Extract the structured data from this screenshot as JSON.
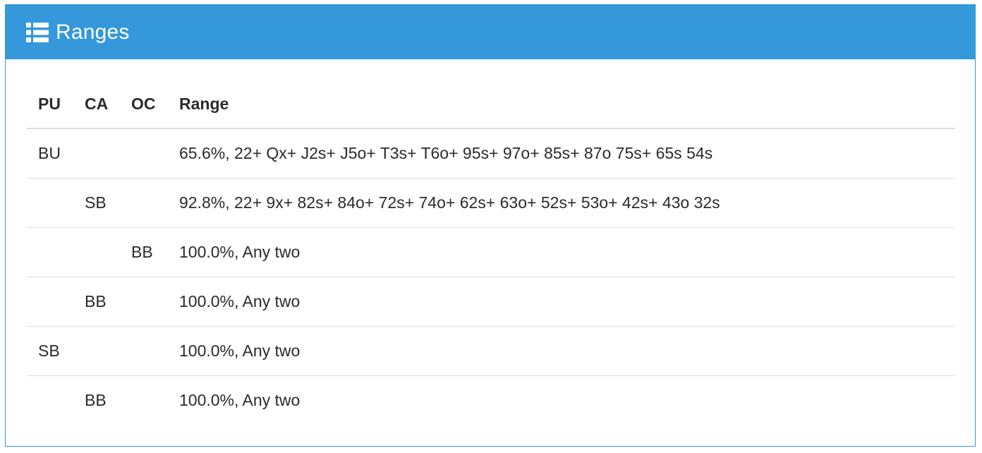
{
  "panel": {
    "title": "Ranges",
    "icon": "list-icon",
    "accent_color": "#3498db"
  },
  "table": {
    "headers": {
      "pu": "PU",
      "ca": "CA",
      "oc": "OC",
      "range": "Range"
    },
    "rows": [
      {
        "pu": "BU",
        "ca": "",
        "oc": "",
        "range": "65.6%, 22+ Qx+ J2s+ J5o+ T3s+ T6o+ 95s+ 97o+ 85s+ 87o 75s+ 65s 54s"
      },
      {
        "pu": "",
        "ca": "SB",
        "oc": "",
        "range": "92.8%, 22+ 9x+ 82s+ 84o+ 72s+ 74o+ 62s+ 63o+ 52s+ 53o+ 42s+ 43o 32s"
      },
      {
        "pu": "",
        "ca": "",
        "oc": "BB",
        "range": "100.0%, Any two"
      },
      {
        "pu": "",
        "ca": "BB",
        "oc": "",
        "range": "100.0%, Any two"
      },
      {
        "pu": "SB",
        "ca": "",
        "oc": "",
        "range": "100.0%, Any two"
      },
      {
        "pu": "",
        "ca": "BB",
        "oc": "",
        "range": "100.0%, Any two"
      }
    ]
  }
}
